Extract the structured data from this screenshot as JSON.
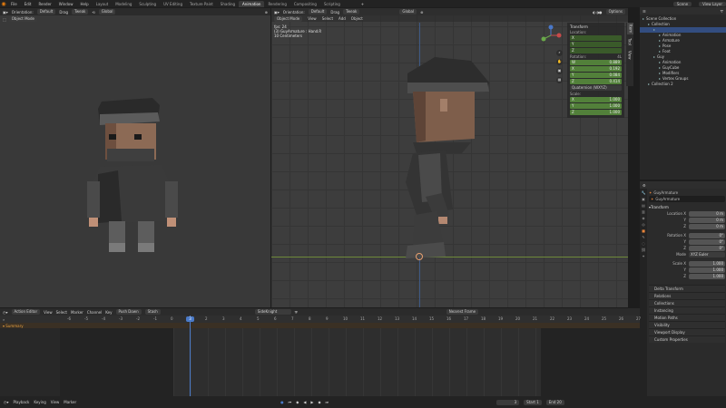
{
  "topbar": {
    "menus": [
      "File",
      "Edit",
      "Render",
      "Window",
      "Help"
    ],
    "tabs": [
      "Layout",
      "Modeling",
      "Sculpting",
      "UV Editing",
      "Texture Paint",
      "Shading",
      "Animation",
      "Rendering",
      "Compositing",
      "Scripting"
    ],
    "active_tab": "Animation",
    "scene": "Scene",
    "view_layer": "View Layer"
  },
  "left_viewport": {
    "mode": "Object Mode",
    "orientation_label": "Orientation:",
    "orientation": "Default",
    "drag_label": "Drag",
    "drag": "Tweak",
    "transform": "Global"
  },
  "main_viewport": {
    "orientation_label": "Orientation:",
    "orientation": "Default",
    "drag_label": "Drag",
    "drag": "Tweak",
    "transform": "Global",
    "options": "Options",
    "mode": "Object Mode",
    "menu": [
      "View",
      "Select",
      "Add",
      "Object"
    ],
    "info": [
      "fps: 24",
      "(3) GuyArmature : Hand.R",
      "10 Centimeters"
    ],
    "npanel": {
      "title": "Transform",
      "location_label": "Location:",
      "rotation_label": "Rotation:",
      "rotation_mode": "Quaternion (WXYZ)",
      "rot_w_label": "4L",
      "scale_label": "Scale:",
      "location": [
        {
          "axis": "X",
          "value": ""
        },
        {
          "axis": "Y",
          "value": ""
        },
        {
          "axis": "Z",
          "value": ""
        }
      ],
      "rotation": [
        {
          "axis": "W",
          "value": "0.889"
        },
        {
          "axis": "X",
          "value": "0.192"
        },
        {
          "axis": "Y",
          "value": "0.084"
        },
        {
          "axis": "Z",
          "value": "0.414"
        }
      ],
      "scale": [
        {
          "axis": "X",
          "value": "1.000"
        },
        {
          "axis": "Y",
          "value": "1.000"
        },
        {
          "axis": "Z",
          "value": "1.000"
        }
      ]
    },
    "side_tabs": [
      "Item",
      "Tool",
      "View"
    ]
  },
  "outliner": {
    "title": "Scene Collection",
    "items": [
      {
        "label": "Scene Collection",
        "indent": 0
      },
      {
        "label": "Collection",
        "indent": 1
      },
      {
        "label": "",
        "indent": 2,
        "selected": true
      },
      {
        "label": "Animation",
        "indent": 3
      },
      {
        "label": "Armature",
        "indent": 3
      },
      {
        "label": "Pose",
        "indent": 3
      },
      {
        "label": "Foot",
        "indent": 3
      },
      {
        "label": "Guy",
        "indent": 2
      },
      {
        "label": "Animation",
        "indent": 3
      },
      {
        "label": "GuyCube",
        "indent": 3
      },
      {
        "label": "Modifiers",
        "indent": 3
      },
      {
        "label": "Vertex Groups",
        "indent": 3
      },
      {
        "label": "Collection 2",
        "indent": 1
      }
    ]
  },
  "properties": {
    "object_name": "GuyArmature",
    "data_name": "GuyArmature",
    "transform_section": "Transform",
    "location_label": "Location X",
    "location": [
      {
        "axis": "",
        "value": "0 m"
      },
      {
        "axis": "Y",
        "value": "0 m"
      },
      {
        "axis": "Z",
        "value": "0 m"
      }
    ],
    "rotation_label": "Rotation X",
    "rotation": [
      {
        "axis": "",
        "value": "0°"
      },
      {
        "axis": "Y",
        "value": "0°"
      },
      {
        "axis": "Z",
        "value": "0°"
      }
    ],
    "mode_label": "Mode",
    "mode_value": "XYZ Euler",
    "scale_label": "Scale X",
    "scale": [
      {
        "axis": "",
        "value": "1.000"
      },
      {
        "axis": "Y",
        "value": "1.000"
      },
      {
        "axis": "Z",
        "value": "1.000"
      }
    ],
    "sections": [
      "Delta Transform",
      "Relations",
      "Collections",
      "Instancing",
      "Motion Paths",
      "Visibility",
      "Viewport Display",
      "Custom Properties"
    ]
  },
  "dopesheet": {
    "editor": "Action Editor",
    "menu": [
      "View",
      "Select",
      "Marker",
      "Channel",
      "Key"
    ],
    "push_down": "Push Down",
    "stash": "Stash",
    "action": "SideKnight",
    "interp": "Nearest Frame",
    "summary": "Summary",
    "ticks": [
      "-6",
      "-5",
      "-4",
      "-3",
      "-2",
      "-1",
      "0",
      "1",
      "2",
      "3",
      "4",
      "5",
      "6",
      "7",
      "8",
      "9",
      "10",
      "11",
      "12",
      "13",
      "14",
      "15",
      "16",
      "17",
      "18",
      "19",
      "20",
      "21",
      "22",
      "23",
      "24",
      "25",
      "26",
      "27"
    ],
    "current_frame": "3"
  },
  "statusbar": {
    "menu": [
      "Playback",
      "Keying",
      "View",
      "Marker"
    ],
    "frame": "3",
    "start_label": "Start",
    "start": "1",
    "end_label": "End",
    "end": "20"
  }
}
